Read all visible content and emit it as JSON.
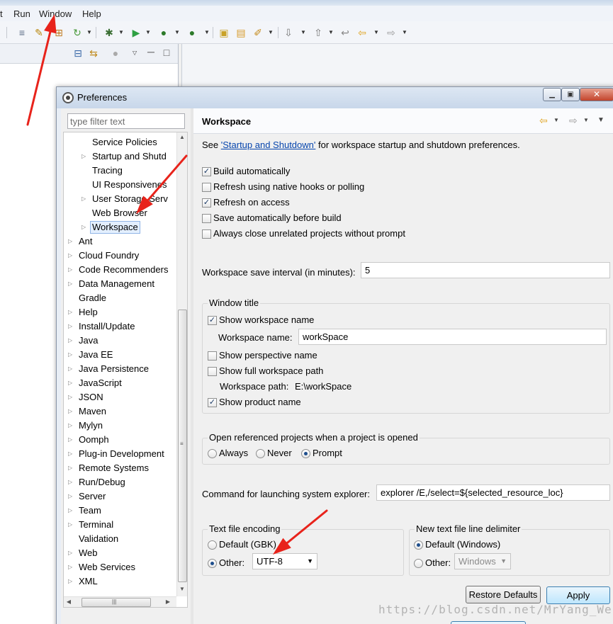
{
  "menubar": {
    "items": [
      "t",
      "Run",
      "Window",
      "Help"
    ]
  },
  "dialog": {
    "title": "Preferences"
  },
  "filter": {
    "placeholder": "type filter text"
  },
  "tree": {
    "items": [
      {
        "label": "Service Policies",
        "level": 2,
        "expandable": false
      },
      {
        "label": "Startup and Shutd",
        "level": 2,
        "expandable": true
      },
      {
        "label": "Tracing",
        "level": 2,
        "expandable": false
      },
      {
        "label": "UI Responsivenes",
        "level": 2,
        "expandable": false
      },
      {
        "label": "User Storage Serv",
        "level": 2,
        "expandable": true
      },
      {
        "label": "Web Browser",
        "level": 2,
        "expandable": false
      },
      {
        "label": "Workspace",
        "level": 2,
        "expandable": true,
        "selected": true
      },
      {
        "label": "Ant",
        "level": 1,
        "expandable": true
      },
      {
        "label": "Cloud Foundry",
        "level": 1,
        "expandable": true
      },
      {
        "label": "Code Recommenders",
        "level": 1,
        "expandable": true
      },
      {
        "label": "Data Management",
        "level": 1,
        "expandable": true
      },
      {
        "label": "Gradle",
        "level": 1,
        "expandable": false
      },
      {
        "label": "Help",
        "level": 1,
        "expandable": true
      },
      {
        "label": "Install/Update",
        "level": 1,
        "expandable": true
      },
      {
        "label": "Java",
        "level": 1,
        "expandable": true
      },
      {
        "label": "Java EE",
        "level": 1,
        "expandable": true
      },
      {
        "label": "Java Persistence",
        "level": 1,
        "expandable": true
      },
      {
        "label": "JavaScript",
        "level": 1,
        "expandable": true
      },
      {
        "label": "JSON",
        "level": 1,
        "expandable": true
      },
      {
        "label": "Maven",
        "level": 1,
        "expandable": true
      },
      {
        "label": "Mylyn",
        "level": 1,
        "expandable": true
      },
      {
        "label": "Oomph",
        "level": 1,
        "expandable": true
      },
      {
        "label": "Plug-in Development",
        "level": 1,
        "expandable": true
      },
      {
        "label": "Remote Systems",
        "level": 1,
        "expandable": true
      },
      {
        "label": "Run/Debug",
        "level": 1,
        "expandable": true
      },
      {
        "label": "Server",
        "level": 1,
        "expandable": true
      },
      {
        "label": "Team",
        "level": 1,
        "expandable": true
      },
      {
        "label": "Terminal",
        "level": 1,
        "expandable": true
      },
      {
        "label": "Validation",
        "level": 1,
        "expandable": false
      },
      {
        "label": "Web",
        "level": 1,
        "expandable": true
      },
      {
        "label": "Web Services",
        "level": 1,
        "expandable": true
      },
      {
        "label": "XML",
        "level": 1,
        "expandable": true
      }
    ]
  },
  "page": {
    "title": "Workspace",
    "see_prefix": "See ",
    "see_link": "'Startup and Shutdown'",
    "see_suffix": " for workspace startup and shutdown preferences.",
    "checks": [
      {
        "label": "Build automatically",
        "checked": true
      },
      {
        "label": "Refresh using native hooks or polling",
        "checked": false
      },
      {
        "label": "Refresh on access",
        "checked": true
      },
      {
        "label": "Save automatically before build",
        "checked": false
      },
      {
        "label": "Always close unrelated projects without prompt",
        "checked": false
      }
    ],
    "save_interval_label": "Workspace save interval (in minutes):",
    "save_interval_value": "5",
    "window_title": {
      "group_label": "Window title",
      "show_workspace_name": {
        "label": "Show workspace name",
        "checked": true
      },
      "workspace_name_label": "Workspace name:",
      "workspace_name_value": "workSpace",
      "show_perspective_name": {
        "label": "Show perspective name",
        "checked": false
      },
      "show_full_path": {
        "label": "Show full workspace path",
        "checked": false
      },
      "workspace_path_label": "Workspace path:",
      "workspace_path_value": "E:\\workSpace",
      "show_product_name": {
        "label": "Show product name",
        "checked": true
      }
    },
    "open_referenced": {
      "group_label": "Open referenced projects when a project is opened",
      "options": [
        "Always",
        "Never",
        "Prompt"
      ],
      "selected": "Prompt"
    },
    "explorer_label": "Command for launching system explorer:",
    "explorer_value": "explorer /E,/select=${selected_resource_loc}",
    "encoding": {
      "group_label": "Text file encoding",
      "default_label": "Default (GBK)",
      "other_label": "Other:",
      "selected": "Other",
      "other_value": "UTF-8"
    },
    "line_delimiter": {
      "group_label": "New text file line delimiter",
      "default_label": "Default (Windows)",
      "other_label": "Other:",
      "selected": "Default",
      "other_value": "Windows"
    },
    "restore_defaults_label": "Restore Defaults",
    "apply_label": "Apply"
  },
  "watermark": "https://blog.csdn.net/MrYang_Wei",
  "colors": {
    "annotation": "#e8231b",
    "link": "#0645ad",
    "selection": "#e3efff"
  }
}
